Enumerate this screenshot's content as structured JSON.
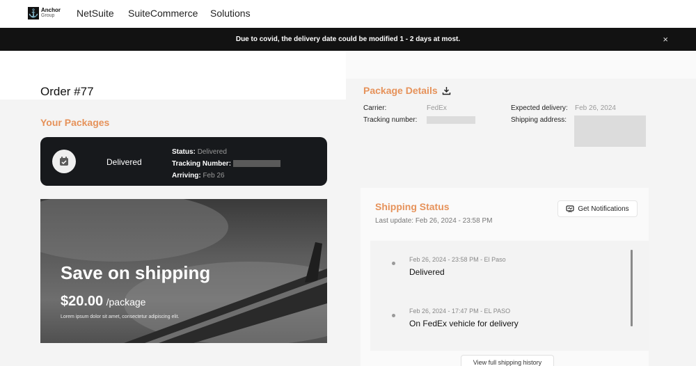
{
  "nav": {
    "logo_line1": "Anchor",
    "logo_line2": "Group",
    "links": [
      "NetSuite",
      "SuiteCommerce",
      "Solutions"
    ]
  },
  "banner": {
    "message": "Due to covid, the delivery date could be modified 1 - 2 days at most.",
    "close_glyph": "×"
  },
  "order": {
    "title": "Order #77",
    "packages_heading": "Your Packages"
  },
  "package_card": {
    "status_large": "Delivered",
    "status_label": "Status:",
    "status_value": "Delivered",
    "tracking_label": "Tracking Number:",
    "arriving_label": "Arriving:",
    "arriving_value": "Feb 26"
  },
  "promo": {
    "title": "Save on shipping",
    "price": "$20.00",
    "unit": "/package",
    "subtitle": "Lorem ipsum dolor sit amet, consectetur adipiscing elit."
  },
  "package_details": {
    "title": "Package Details",
    "carrier_label": "Carrier:",
    "carrier_value": "FedEx",
    "tracking_label": "Tracking number:",
    "expected_label": "Expected delivery:",
    "expected_value": "Feb 26, 2024",
    "address_label": "Shipping address:"
  },
  "shipping_status": {
    "title": "Shipping Status",
    "last_update": "Last update: Feb 26, 2024 - 23:58 PM",
    "notify_button": "Get Notifications",
    "events": [
      {
        "meta": "Feb 26, 2024 - 23:58 PM - El Paso",
        "label": "Delivered"
      },
      {
        "meta": "Feb 26, 2024 - 17:47 PM - EL PASO",
        "label": "On FedEx vehicle for delivery"
      }
    ],
    "history_button": "View full shipping history"
  },
  "colors": {
    "accent": "#e6925a",
    "dark_card": "#17191c",
    "banner": "#121212"
  }
}
